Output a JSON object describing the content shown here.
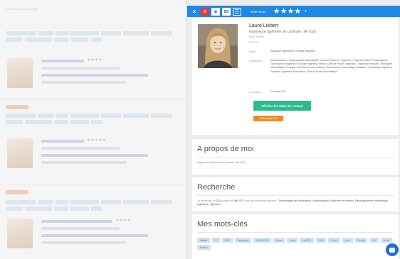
{
  "toolbar": {
    "label": "Noté sous :",
    "stars": "★★★★",
    "caret": "▾",
    "btn_close": "✕",
    "btn_x": "✕",
    "btn_star": "★",
    "btn_mail": "✉",
    "btn_menu": "☰"
  },
  "profile": {
    "name": "Laure Liebert",
    "job": "Ingénieure diplômée de Centrale Lille (G2)",
    "location": "Lyon, France",
    "meta": "Disponible",
    "rows": [
      {
        "label": "Statut",
        "value": "Étudiante ingénieure Centrale Marseille"
      },
      {
        "label": "Expérience",
        "value": "Administrateur / Responsable administratif, Conseil / Associé, Ingénieur / Ingénieur R&D, Professionnel, Technicien et Ingénieur, Groupe Ingénieur Sénior, Chef de Projet, Ingénieur / Ingénieur d'études, Technicien informatique, Chargée d'Études en Informatique, Développeur informatique, Analyste, Consultant, Ingénieur Système, Ingénieur Formateur, Chef de Projet Informatique"
      },
      {
        "label": "Formation",
        "value": "Centrale Lille"
      }
    ],
    "btn_contact": "Afficher les infos de contact",
    "btn_cv": "Télécharger CV"
  },
  "about": {
    "title": "A propos de moi",
    "text": "Ingénieure diplômée de Centrale Lille (G2)"
  },
  "research": {
    "title": "Recherche",
    "text_prefix": "Je recherche un",
    "contract": "CDI",
    "text_mid": "à partir de",
    "date": "Mai 2017",
    "text_sector": "dans les domaines suivants :",
    "domains": "Technologies de l'information, Administrateur Systèmes et réseaux, Développement informatique, Ingénierie, Ingénieur"
  },
  "keywords": {
    "title": "Mes mots-clés",
    "items": [
      "Matlab",
      "C",
      "PHP",
      "Javascript",
      "HTML/CSS",
      "Linux",
      "Java",
      "MySQL",
      "SQL",
      "Excel",
      "Unix",
      "Prolog",
      "Git",
      "Word",
      "Python"
    ]
  },
  "background": {
    "top_text": "Résultats de la recherche",
    "chips": [
      42,
      22,
      18,
      40,
      28,
      36,
      30,
      24,
      38,
      20,
      26,
      16
    ],
    "entries": [
      {
        "stars": "★★★★"
      },
      {
        "stars": "★★★★★"
      },
      {
        "stars": "★★★★"
      }
    ]
  }
}
